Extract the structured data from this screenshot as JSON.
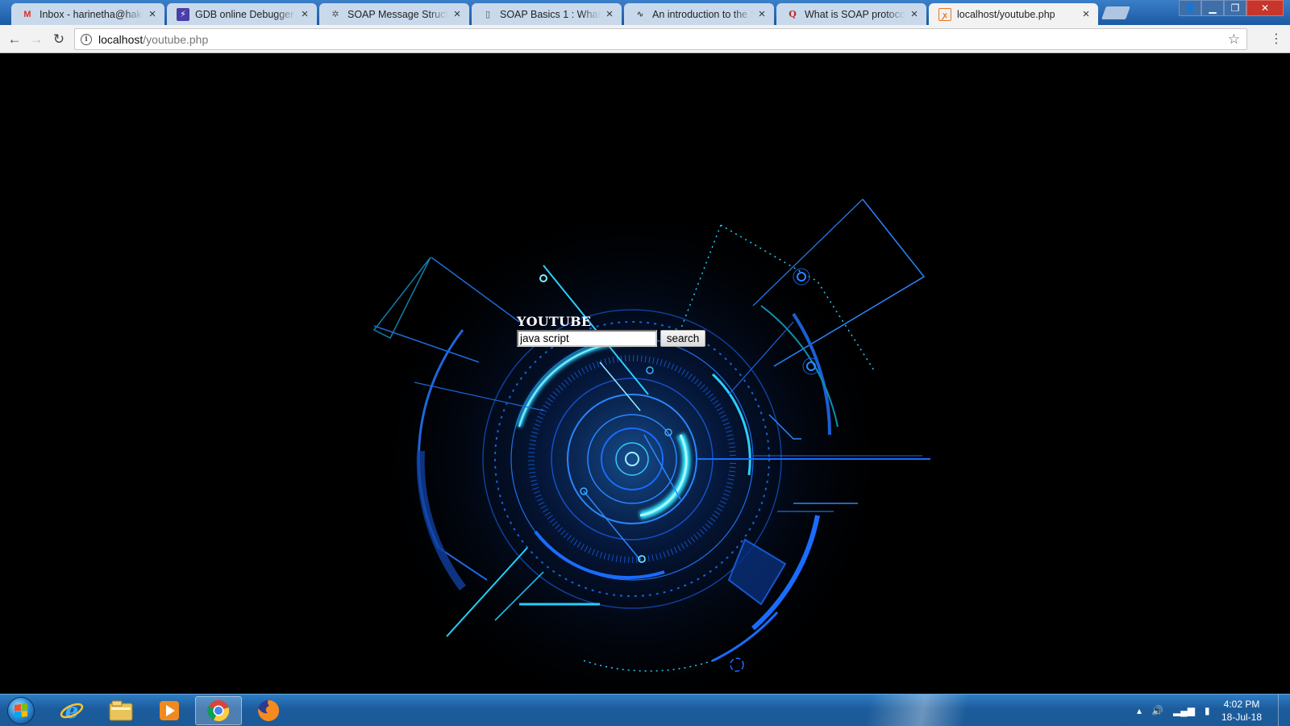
{
  "browser": {
    "tabs": [
      {
        "title": "Inbox - harinetha@hakun",
        "icon": "gmail-icon",
        "active": false
      },
      {
        "title": "GDB online Debugger | C",
        "icon": "lightning-icon",
        "active": false
      },
      {
        "title": "SOAP Message Structure",
        "icon": "gear-logo-icon",
        "active": false
      },
      {
        "title": "SOAP Basics 1 : What is S",
        "icon": "page-icon",
        "active": false
      },
      {
        "title": "An introduction to the Si",
        "icon": "wave-icon",
        "active": false
      },
      {
        "title": "What is SOAP protocol? -",
        "icon": "quora-icon",
        "active": false
      },
      {
        "title": "localhost/youtube.php",
        "icon": "xampp-icon",
        "active": true
      }
    ],
    "close_glyph": "×",
    "address": {
      "host": "localhost",
      "path": "/youtube.php"
    }
  },
  "page": {
    "heading": "YOUTUBE",
    "search_value": "java script",
    "search_button": "search"
  },
  "taskbar": {
    "apps": [
      "internet-explorer-icon",
      "file-explorer-icon",
      "media-player-icon",
      "chrome-icon",
      "firefox-icon"
    ],
    "clock_time": "4:02 PM",
    "clock_date": "18-Jul-18"
  },
  "colors": {
    "accent_cyan": "#22e4ff",
    "accent_blue": "#1a6cff",
    "taskbar": "#1c5c9c",
    "tab_active": "#f2f2f2"
  }
}
